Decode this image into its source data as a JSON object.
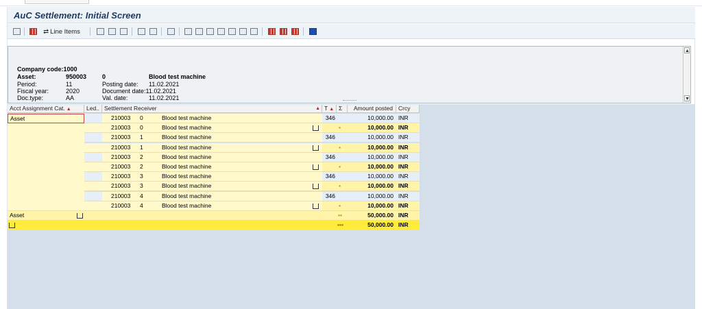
{
  "window": {
    "title": "AuC Settlement: Initial Screen"
  },
  "toolbar": {
    "line_items_label": "Line Items",
    "icons": [
      "detail-icon",
      "layout-icon",
      "line-items-icon",
      "print-icon",
      "filter-icon",
      "filter-set-icon",
      "sum-icon",
      "subtotal-icon",
      "refresh-icon",
      "export-icon",
      "mail-icon",
      "excel-icon",
      "text-icon",
      "word-icon",
      "graphic-icon",
      "abc-icon",
      "choose-layout-icon",
      "change-layout-icon",
      "save-layout-icon",
      "info-icon"
    ]
  },
  "header": {
    "company_code_label": "Company code:",
    "company_code": "1000",
    "asset_label": "Asset:",
    "asset_number": "950003",
    "asset_sub": "0",
    "asset_text": "Blood test machine",
    "period_label": "Period:",
    "period": "11",
    "fiscal_year_label": "Fiscal year:",
    "fiscal_year": "2020",
    "doc_type_label": "Doc.type:",
    "doc_type": "AA",
    "posting_date_label": "Posting date:",
    "posting_date": "11.02.2021",
    "document_date_label": "Document date:",
    "document_date": "11.02.2021",
    "val_date_label": "Val. date:",
    "val_date": "11.02.2021"
  },
  "grid": {
    "columns": {
      "acct_assignment": "Acct Assignment Cat.",
      "ledger": "Led..",
      "receiver": "Settlement Receiver",
      "t": "T",
      "sigma": "Σ",
      "amount": "Amount posted",
      "crcy": "Crcy"
    },
    "first_category": "Asset",
    "rows": [
      {
        "receiver": "210003",
        "sub": "0",
        "text": "Blood test machine",
        "t": "346",
        "amount": "10,000.00",
        "crcy": "INR",
        "subtotal": false
      },
      {
        "receiver": "210003",
        "sub": "0",
        "text": "Blood test machine",
        "t": "",
        "amount": "10,000.00",
        "crcy": "INR",
        "subtotal": true
      },
      {
        "receiver": "210003",
        "sub": "1",
        "text": "Blood test machine",
        "t": "346",
        "amount": "10,000.00",
        "crcy": "INR",
        "subtotal": false
      },
      {
        "receiver": "210003",
        "sub": "1",
        "text": "Blood test machine",
        "t": "",
        "amount": "10,000.00",
        "crcy": "INR",
        "subtotal": true
      },
      {
        "receiver": "210003",
        "sub": "2",
        "text": "Blood test machine",
        "t": "346",
        "amount": "10,000.00",
        "crcy": "INR",
        "subtotal": false
      },
      {
        "receiver": "210003",
        "sub": "2",
        "text": "Blood test machine",
        "t": "",
        "amount": "10,000.00",
        "crcy": "INR",
        "subtotal": true
      },
      {
        "receiver": "210003",
        "sub": "3",
        "text": "Blood test machine",
        "t": "346",
        "amount": "10,000.00",
        "crcy": "INR",
        "subtotal": false
      },
      {
        "receiver": "210003",
        "sub": "3",
        "text": "Blood test machine",
        "t": "",
        "amount": "10,000.00",
        "crcy": "INR",
        "subtotal": true
      },
      {
        "receiver": "210003",
        "sub": "4",
        "text": "Blood test machine",
        "t": "346",
        "amount": "10,000.00",
        "crcy": "INR",
        "subtotal": false
      },
      {
        "receiver": "210003",
        "sub": "4",
        "text": "Blood test machine",
        "t": "",
        "amount": "10,000.00",
        "crcy": "INR",
        "subtotal": true
      }
    ],
    "asset_total": {
      "category": "Asset",
      "amount": "50,000.00",
      "crcy": "INR"
    },
    "grand_total": {
      "amount": "50,000.00",
      "crcy": "INR"
    }
  }
}
